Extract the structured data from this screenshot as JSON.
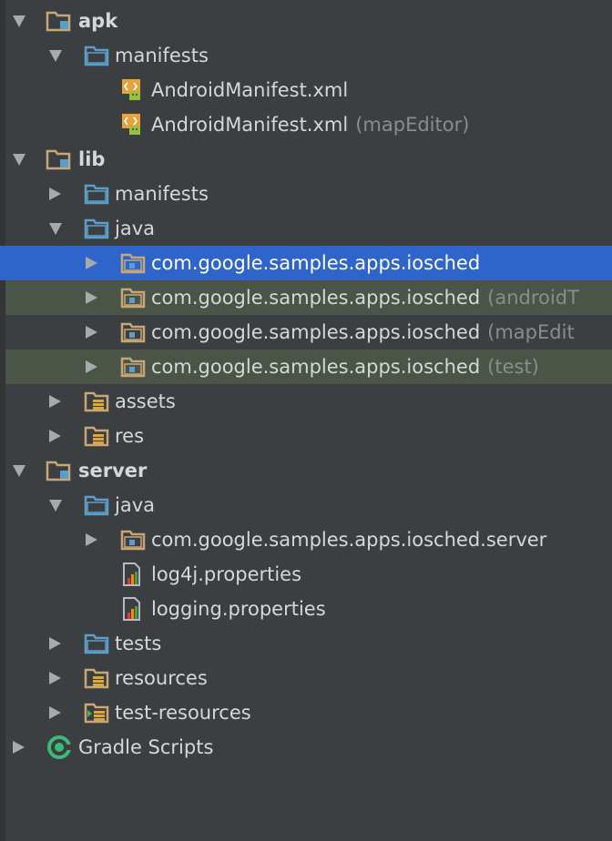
{
  "rows": [
    {
      "name": "module-apk",
      "label": "apk",
      "suffix": "",
      "arrow": "down",
      "icon": "module-folder-icon",
      "level": 0,
      "bold": true
    },
    {
      "name": "folder-apk-manifests",
      "label": "manifests",
      "suffix": "",
      "arrow": "down",
      "icon": "folder-icon",
      "level": 1
    },
    {
      "name": "file-androidmanifest",
      "label": "AndroidManifest.xml",
      "suffix": "",
      "arrow": "",
      "icon": "android-manifest-icon",
      "level": 2
    },
    {
      "name": "file-androidmanifest-mapeditor",
      "label": "AndroidManifest.xml",
      "suffix": "(mapEditor)",
      "arrow": "",
      "icon": "android-manifest-icon",
      "level": 2
    },
    {
      "name": "module-lib",
      "label": "lib",
      "suffix": "",
      "arrow": "down",
      "icon": "module-folder-icon",
      "level": 0,
      "bold": true
    },
    {
      "name": "folder-lib-manifests",
      "label": "manifests",
      "suffix": "",
      "arrow": "right",
      "icon": "folder-icon",
      "level": 1
    },
    {
      "name": "folder-lib-java",
      "label": "java",
      "suffix": "",
      "arrow": "down",
      "icon": "folder-icon",
      "level": 1
    },
    {
      "name": "package-iosched",
      "label": "com.google.samples.apps.iosched",
      "suffix": "",
      "arrow": "right",
      "icon": "package-icon",
      "level": 2,
      "state": "selected"
    },
    {
      "name": "package-iosched-androidtest",
      "label": "com.google.samples.apps.iosched",
      "suffix": "(androidT",
      "arrow": "right",
      "icon": "package-icon",
      "level": 2,
      "state": "tinted"
    },
    {
      "name": "package-iosched-mapeditor",
      "label": "com.google.samples.apps.iosched",
      "suffix": "(mapEdit",
      "arrow": "right",
      "icon": "package-icon",
      "level": 2
    },
    {
      "name": "package-iosched-test",
      "label": "com.google.samples.apps.iosched",
      "suffix": "(test)",
      "arrow": "right",
      "icon": "package-icon",
      "level": 2,
      "state": "tinted"
    },
    {
      "name": "folder-lib-assets",
      "label": "assets",
      "suffix": "",
      "arrow": "right",
      "icon": "resource-folder-icon",
      "level": 1
    },
    {
      "name": "folder-lib-res",
      "label": "res",
      "suffix": "",
      "arrow": "right",
      "icon": "resource-folder-icon",
      "level": 1
    },
    {
      "name": "module-server",
      "label": "server",
      "suffix": "",
      "arrow": "down",
      "icon": "module-folder-icon",
      "level": 0,
      "bold": true
    },
    {
      "name": "folder-server-java",
      "label": "java",
      "suffix": "",
      "arrow": "down",
      "icon": "folder-icon",
      "level": 1
    },
    {
      "name": "package-iosched-server",
      "label": "com.google.samples.apps.iosched.server",
      "suffix": "",
      "arrow": "right",
      "icon": "package-icon",
      "level": 2
    },
    {
      "name": "file-log4j-properties",
      "label": "log4j.properties",
      "suffix": "",
      "arrow": "",
      "icon": "properties-file-icon",
      "level": 2
    },
    {
      "name": "file-logging-properties",
      "label": "logging.properties",
      "suffix": "",
      "arrow": "",
      "icon": "properties-file-icon",
      "level": 2
    },
    {
      "name": "folder-server-tests",
      "label": "tests",
      "suffix": "",
      "arrow": "right",
      "icon": "folder-icon",
      "level": 1
    },
    {
      "name": "folder-server-resources",
      "label": "resources",
      "suffix": "",
      "arrow": "right",
      "icon": "resource-folder-icon",
      "level": 1
    },
    {
      "name": "folder-server-test-resources",
      "label": "test-resources",
      "suffix": "",
      "arrow": "right",
      "icon": "test-resource-folder-icon",
      "level": 1
    },
    {
      "name": "gradle-scripts",
      "label": "Gradle Scripts",
      "suffix": "",
      "arrow": "right",
      "icon": "gradle-icon",
      "level": 0
    }
  ],
  "colors": {
    "background": "#3c3f41",
    "selection": "#2f65ca",
    "tinted_row": "#4a5447",
    "folder_blue": "#5b9ec9",
    "module_tan": "#c9a675",
    "gradle_green": "#3bb87a"
  }
}
